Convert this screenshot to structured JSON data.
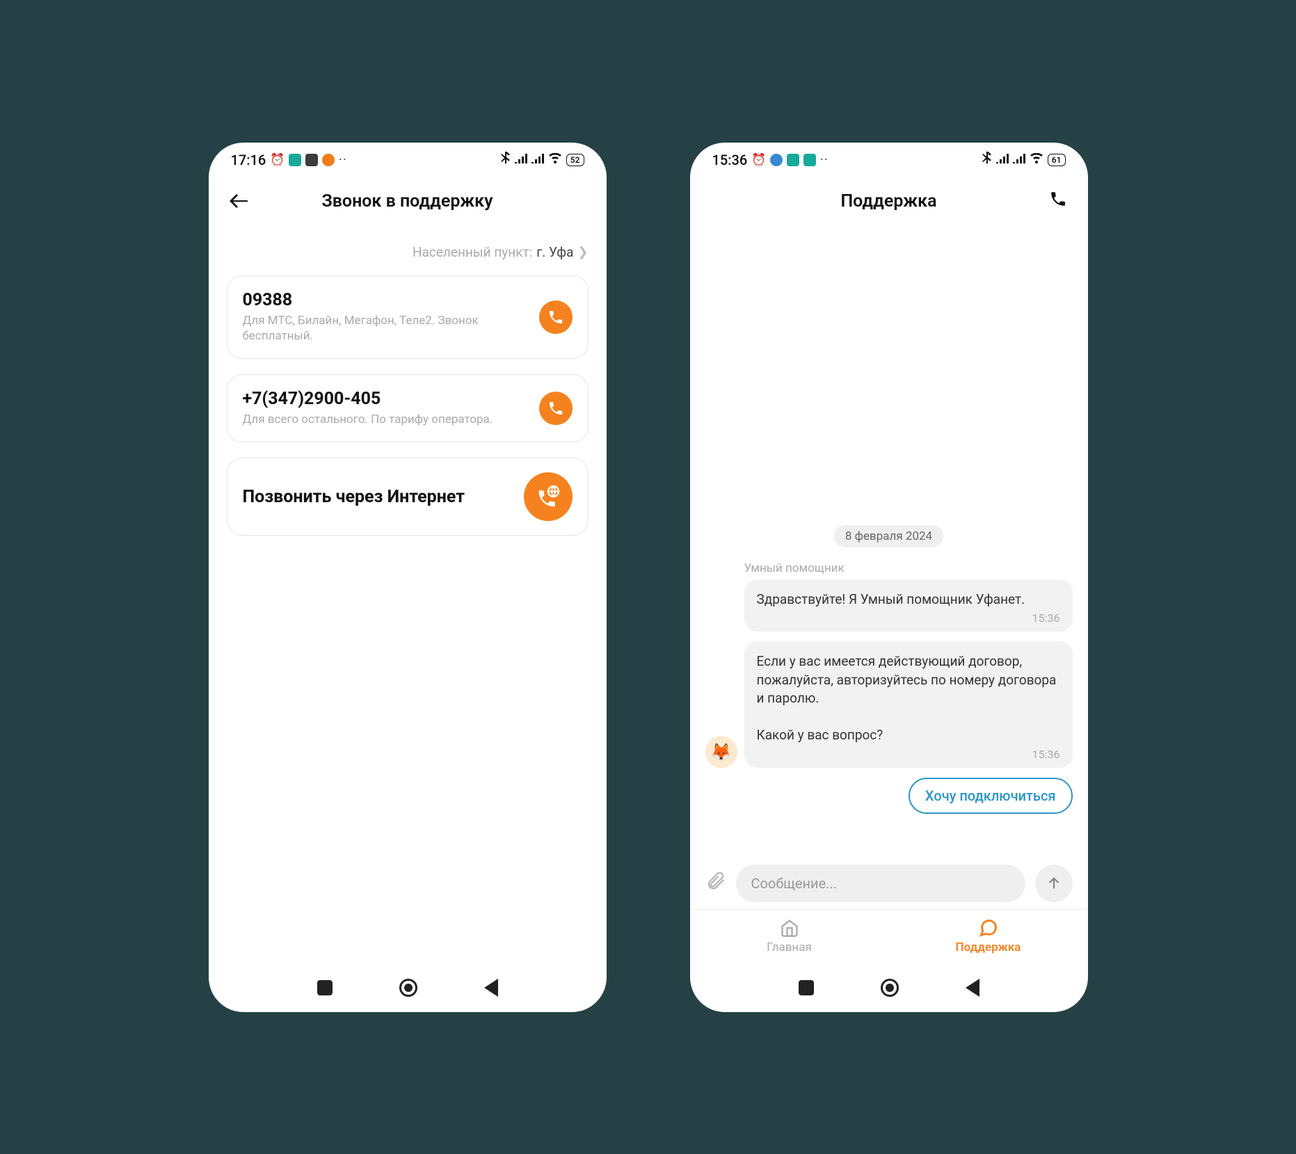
{
  "phone1": {
    "status": {
      "time": "17:16",
      "battery": "52"
    },
    "header": {
      "title": "Звонок в поддержку"
    },
    "locality": {
      "label": "Населенный пункт:",
      "value": "г. Уфа"
    },
    "cards": [
      {
        "number": "09388",
        "desc": "Для МТС, Билайн, Мегафон, Теле2. Звонок бесплатный."
      },
      {
        "number": "+7(347)2900-405",
        "desc": "Для всего остального. По тарифу оператора."
      }
    ],
    "internet_call": {
      "title": "Позвонить через Интернет"
    }
  },
  "phone2": {
    "status": {
      "time": "15:36",
      "battery": "61"
    },
    "header": {
      "title": "Поддержка"
    },
    "chat": {
      "date": "8 февраля 2024",
      "sender": "Умный помощник",
      "messages": [
        {
          "text": "Здравствуйте! Я Умный помощник Уфанет.",
          "time": "15:36"
        },
        {
          "text": "Если у вас имеется действующий договор, пожалуйста, авторизуйтесь по номеру договора и паролю.\n\nКакой у вас вопрос?",
          "time": "15:36"
        }
      ],
      "quick_reply": "Хочу подключиться",
      "input_placeholder": "Сообщение..."
    },
    "tabs": {
      "home": "Главная",
      "support": "Поддержка"
    }
  }
}
